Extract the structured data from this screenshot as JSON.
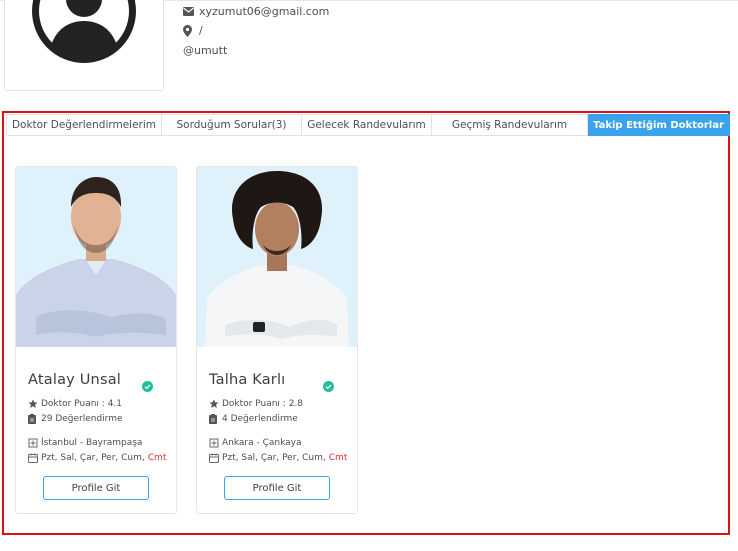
{
  "profile": {
    "email": "xyzumut06@gmail.com",
    "location": "/",
    "handle": "@umutt"
  },
  "tabs": [
    {
      "label": "Doktor Değerlendirmelerim"
    },
    {
      "label": "Sorduğum Sorular(3)"
    },
    {
      "label": "Gelecek Randevularım"
    },
    {
      "label": "Geçmiş Randevularım"
    },
    {
      "label": "Takip Ettiğim Doktorlar",
      "active": true
    }
  ],
  "doctors": [
    {
      "name": "Atalay Unsal",
      "rating": "Doktor Puanı : 4.1",
      "reviews": "29 Değerlendirme",
      "location": "İstanbul - Bayrampaşa",
      "days": "Pzt, Sal, Çar, Per, Cum,",
      "day_off": "Cmt",
      "button": "Profile Git"
    },
    {
      "name": "Talha Karlı",
      "rating": "Doktor Puanı : 2.8",
      "reviews": "4 Değerlendirme",
      "location": "Ankara - Çankaya",
      "days": "Pzt, Sal, Çar, Per, Cum,",
      "day_off": "Cmt",
      "button": "Profile Git"
    }
  ],
  "colors": {
    "accent": "#3aa3ee",
    "highlight_border": "#dc1111",
    "verified": "#1fbf9a",
    "day_off": "#e03131",
    "photo_bg": "#dff1fb"
  },
  "icons": {
    "email": "envelope-icon",
    "location": "map-pin-icon",
    "rating": "star-icon",
    "reviews": "clipboard-icon",
    "address": "hospital-icon",
    "schedule": "calendar-icon",
    "verified": "check-circle-icon"
  }
}
